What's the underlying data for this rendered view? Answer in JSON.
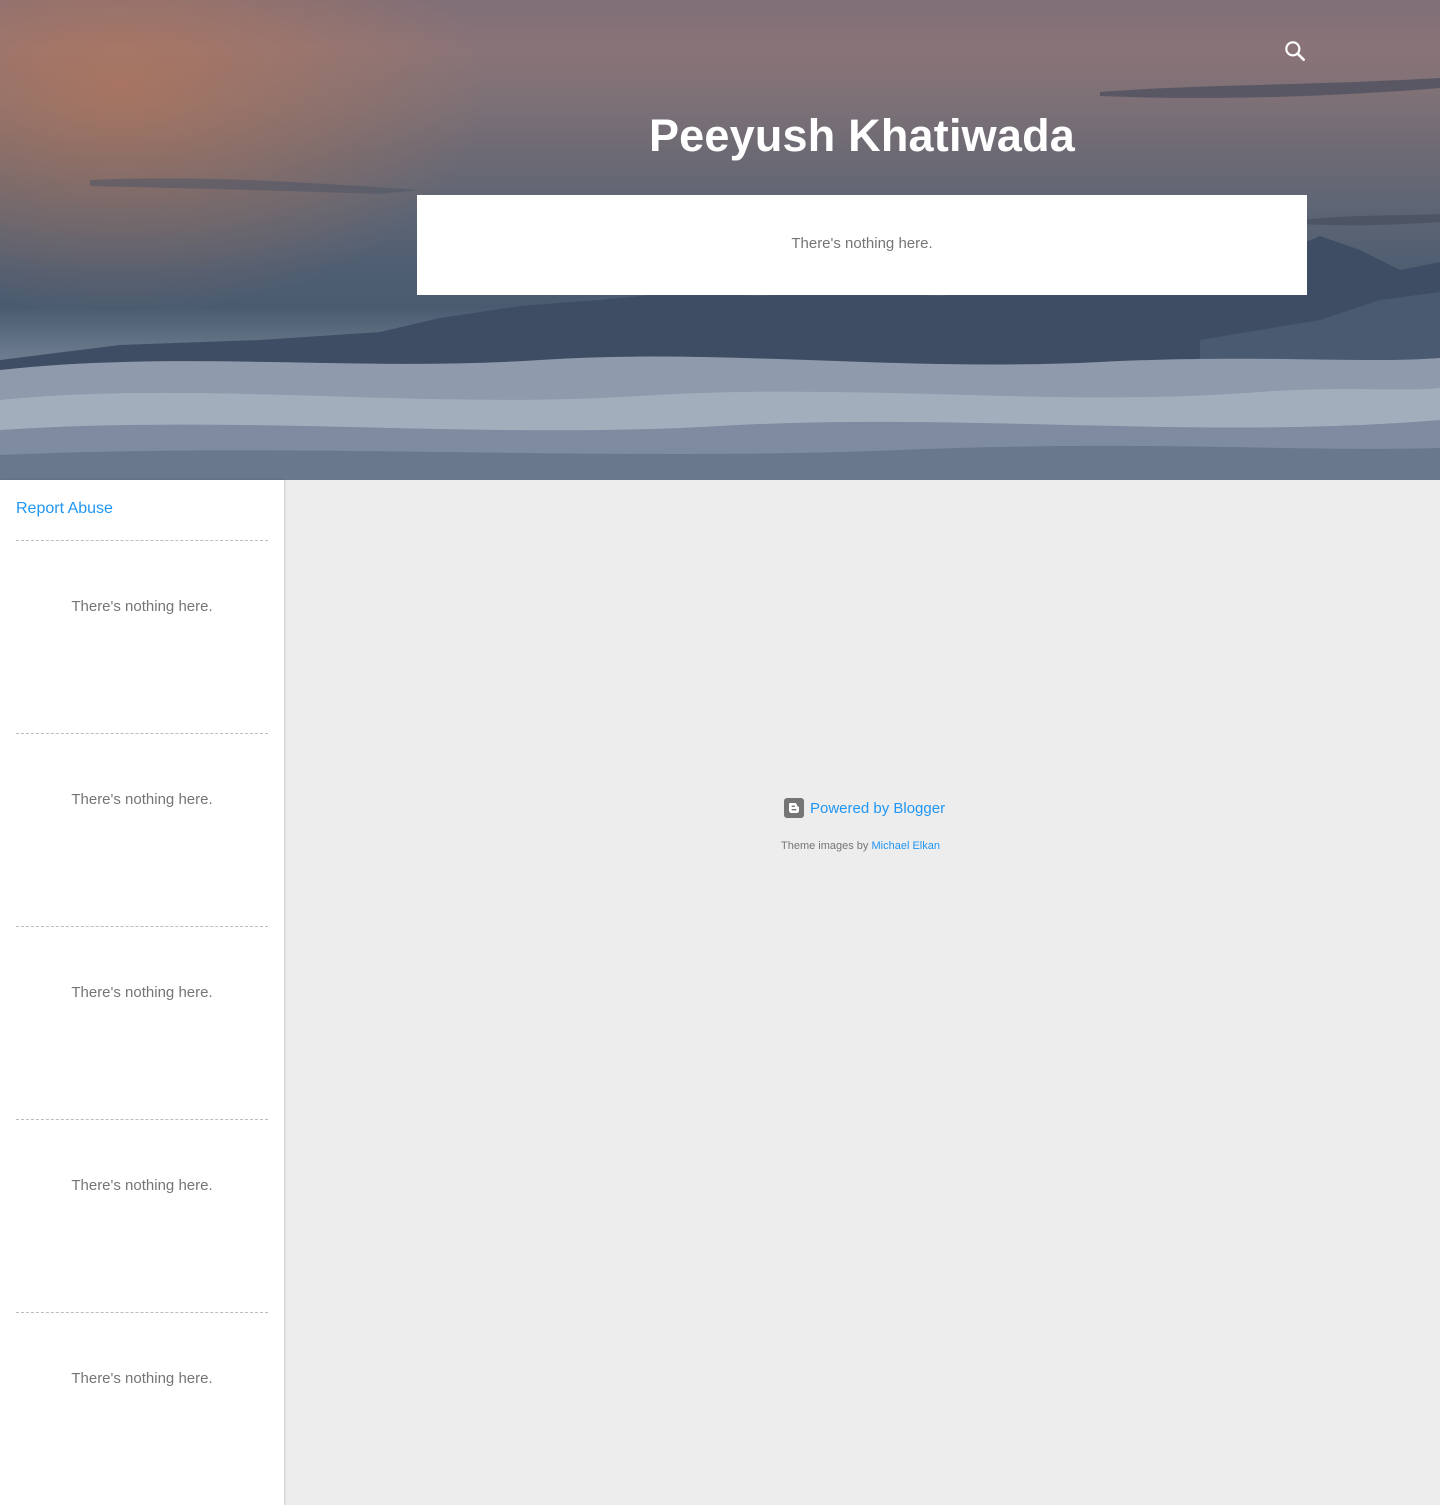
{
  "header": {
    "title": "Peeyush Khatiwada",
    "search_icon": "search-icon"
  },
  "main": {
    "empty_message": "There's nothing here."
  },
  "sidebar": {
    "report_abuse": "Report Abuse",
    "widgets": [
      {
        "message": "There's nothing here."
      },
      {
        "message": "There's nothing here."
      },
      {
        "message": "There's nothing here."
      },
      {
        "message": "There's nothing here."
      },
      {
        "message": "There's nothing here."
      }
    ]
  },
  "footer": {
    "powered_by": "Powered by Blogger",
    "blogger_icon": "blogger-icon",
    "theme_prefix": "Theme images by",
    "theme_author": "Michael Elkan"
  },
  "colors": {
    "accent": "#2196f3",
    "text": "#757575",
    "background": "#ededed",
    "card": "#ffffff"
  }
}
